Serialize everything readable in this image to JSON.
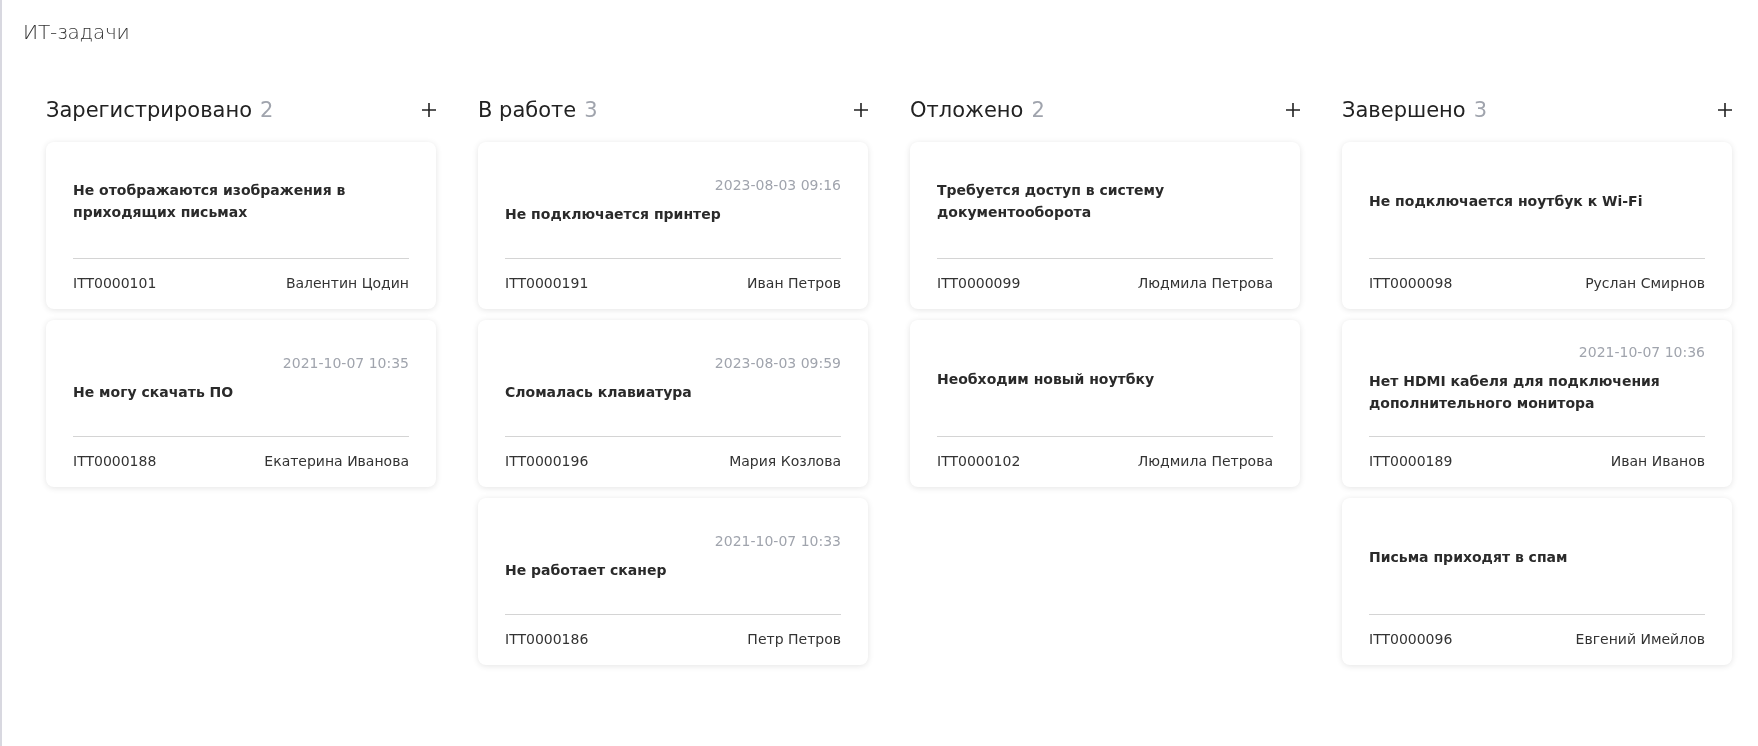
{
  "page_title": "ИТ-задачи",
  "columns": [
    {
      "title": "Зарегистрировано",
      "count": "2",
      "cards": [
        {
          "title": "Не отображаются изображения в приходящих письмах",
          "number": "ITT0000101",
          "assignee": "Валентин Цодин"
        },
        {
          "date": "2021-10-07 10:35",
          "title": "Не могу скачать ПО",
          "number": "ITT0000188",
          "assignee": "Екатерина Иванова"
        }
      ]
    },
    {
      "title": "В работе",
      "count": "3",
      "cards": [
        {
          "date": "2023-08-03 09:16",
          "title": "Не подключается принтер",
          "number": "ITT0000191",
          "assignee": "Иван Петров"
        },
        {
          "date": "2023-08-03 09:59",
          "title": "Сломалась клавиатура",
          "number": "ITT0000196",
          "assignee": "Мария Козлова"
        },
        {
          "date": "2021-10-07 10:33",
          "title": "Не работает сканер",
          "number": "ITT0000186",
          "assignee": "Петр Петров"
        }
      ]
    },
    {
      "title": "Отложено",
      "count": "2",
      "cards": [
        {
          "title": "Требуется доступ в систему документооборота",
          "number": "ITT0000099",
          "assignee": "Людмила Петрова"
        },
        {
          "title": "Необходим новый ноутбку",
          "number": "ITT0000102",
          "assignee": "Людмила Петрова"
        }
      ]
    },
    {
      "title": "Завершено",
      "count": "3",
      "cards": [
        {
          "title": "Не подключается ноутбук к Wi-Fi",
          "number": "ITT0000098",
          "assignee": "Руслан Смирнов"
        },
        {
          "date": "2021-10-07 10:36",
          "title": "Нет HDMI кабеля для подключения дополнительного монитора",
          "number": "ITT0000189",
          "assignee": "Иван Иванов"
        },
        {
          "title": "Письма приходят в спам",
          "number": "ITT0000096",
          "assignee": "Евгений Имейлов"
        }
      ]
    }
  ]
}
